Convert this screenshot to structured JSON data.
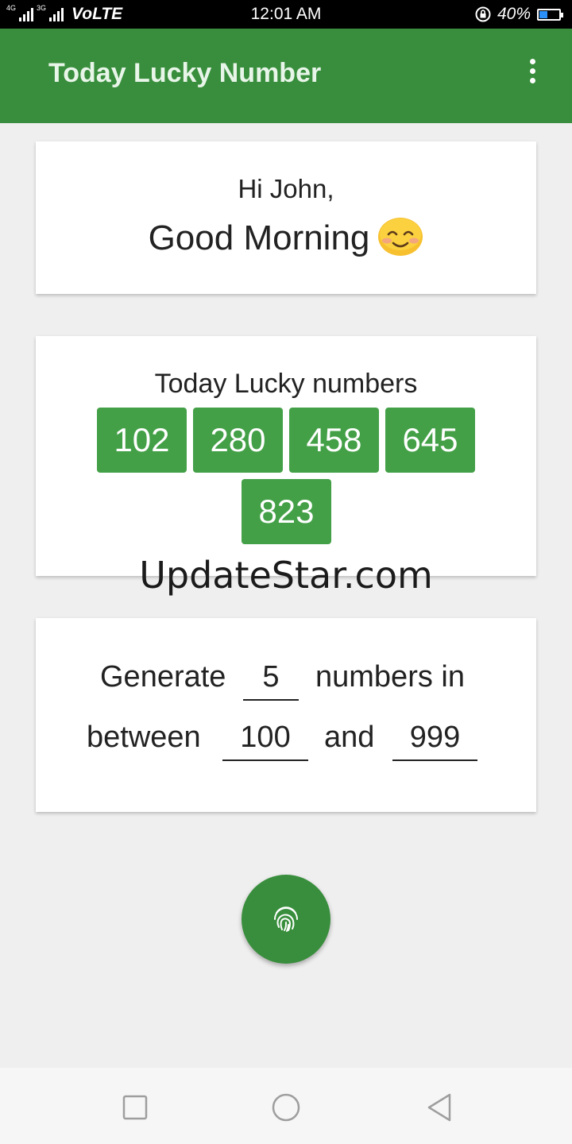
{
  "status_bar": {
    "network_1": "4G",
    "network_2": "3G",
    "volte": "VoLTE",
    "time": "12:01 AM",
    "battery_percent": "40%",
    "battery_level": 0.4
  },
  "app_bar": {
    "title": "Today Lucky Number",
    "menu_icon": "more-vert-icon"
  },
  "greeting": {
    "hi": "Hi John,",
    "message": "Good Morning",
    "emoji": "smiling-face-icon"
  },
  "lucky": {
    "title": "Today Lucky numbers",
    "numbers": [
      "102",
      "280",
      "458",
      "645",
      "823"
    ]
  },
  "watermark": "UpdateStar.com",
  "generator": {
    "label_generate": "Generate",
    "count": "5",
    "label_numbers_in": "numbers in",
    "label_between": "between",
    "min": "100",
    "label_and": "and",
    "max": "999"
  },
  "fab": {
    "icon": "fingerprint-icon"
  },
  "nav": {
    "recents_icon": "square-icon",
    "home_icon": "circle-icon",
    "back_icon": "triangle-back-icon"
  },
  "colors": {
    "primary": "#388e3c",
    "chip": "#43a047",
    "background": "#efefef"
  }
}
